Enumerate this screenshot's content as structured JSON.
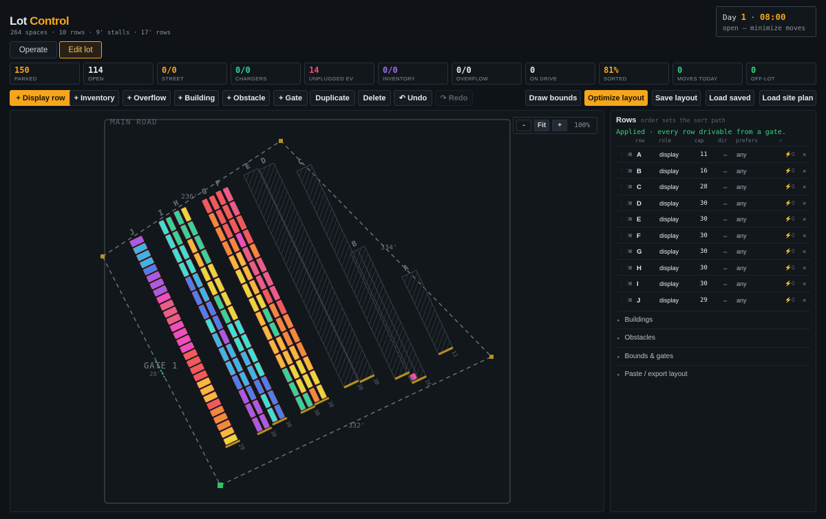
{
  "header": {
    "brand_a": "Lot",
    "brand_b": "Control",
    "subtitle": "264 spaces · 10 rows · 9' stalls · 17' rows",
    "modes": [
      "Operate",
      "Edit lot"
    ]
  },
  "clock": {
    "day_label": "Day",
    "day": "1",
    "time": "08:00",
    "sep": "·",
    "status": "open — minimize moves"
  },
  "stats": [
    {
      "value": "150",
      "label": "PARKED",
      "color": "#f5a61b"
    },
    {
      "value": "114",
      "label": "OPEN",
      "color": "#e6e9ee"
    },
    {
      "value": "0/0",
      "label": "STREET",
      "color": "#f5a61b"
    },
    {
      "value": "0/0",
      "label": "CHARGERS",
      "color": "#34d39a"
    },
    {
      "value": "14",
      "label": "UNPLUGGED EV",
      "color": "#f0506e"
    },
    {
      "value": "0/0",
      "label": "INVENTORY",
      "color": "#a06ee8"
    },
    {
      "value": "0/0",
      "label": "OVERFLOW",
      "color": "#e6e9ee"
    },
    {
      "value": "0",
      "label": "ON DRIVE",
      "color": "#e6e9ee"
    },
    {
      "value": "81%",
      "label": "SORTED",
      "color": "#f5a61b"
    },
    {
      "value": "0",
      "label": "MOVES TODAY",
      "color": "#34d37a"
    },
    {
      "value": "0",
      "label": "OFF-LOT",
      "color": "#34d37a"
    }
  ],
  "toolbar": {
    "left": [
      "+ Display row",
      "+ Inventory",
      "+ Overflow",
      "+ Building",
      "+ Obstacle",
      "+ Gate",
      "Duplicate",
      "Delete",
      "↶ Undo",
      "↷ Redo"
    ],
    "right": [
      "Draw bounds",
      "Optimize layout",
      "Save layout",
      "Load saved",
      "Load site plan"
    ]
  },
  "canvas": {
    "road_label": "MAIN ROAD",
    "gate_label": "GATE 1",
    "gate_sub": "28'",
    "dims": [
      "236'",
      "334'",
      "332'"
    ],
    "zoom": {
      "minus": "-",
      "fit": "Fit",
      "plus": "+",
      "level": "100%"
    }
  },
  "panel": {
    "title": "Rows",
    "subtitle": "order sets the sort path",
    "applied": "Applied · every row drivable from a gate.",
    "columns": [
      "row",
      "role",
      "cap",
      "dir",
      "prefers",
      "⚡"
    ],
    "rows": [
      {
        "name": "A",
        "role": "display",
        "cap": "11",
        "dir": "⇔",
        "prefers": "any",
        "ev": "⚡0"
      },
      {
        "name": "B",
        "role": "display",
        "cap": "16",
        "dir": "⇔",
        "prefers": "any",
        "ev": "⚡0"
      },
      {
        "name": "C",
        "role": "display",
        "cap": "28",
        "dir": "⇔",
        "prefers": "any",
        "ev": "⚡0"
      },
      {
        "name": "D",
        "role": "display",
        "cap": "30",
        "dir": "⇔",
        "prefers": "any",
        "ev": "⚡0"
      },
      {
        "name": "E",
        "role": "display",
        "cap": "30",
        "dir": "⇔",
        "prefers": "any",
        "ev": "⚡0"
      },
      {
        "name": "F",
        "role": "display",
        "cap": "30",
        "dir": "⇔",
        "prefers": "any",
        "ev": "⚡0"
      },
      {
        "name": "G",
        "role": "display",
        "cap": "30",
        "dir": "⇔",
        "prefers": "any",
        "ev": "⚡0"
      },
      {
        "name": "H",
        "role": "display",
        "cap": "30",
        "dir": "⇔",
        "prefers": "any",
        "ev": "⚡0"
      },
      {
        "name": "I",
        "role": "display",
        "cap": "30",
        "dir": "⇔",
        "prefers": "any",
        "ev": "⚡0"
      },
      {
        "name": "J",
        "role": "display",
        "cap": "29",
        "dir": "⇔",
        "prefers": "any",
        "ev": "⚡0"
      }
    ],
    "sections": [
      "Buildings",
      "Obstacles",
      "Bounds & gates",
      "Paste / export layout"
    ],
    "remove_glyph": "×",
    "caret": "▸"
  },
  "colors": {
    "accent": "#f5a61b",
    "ok": "#34d37a",
    "alert": "#f0506e"
  }
}
